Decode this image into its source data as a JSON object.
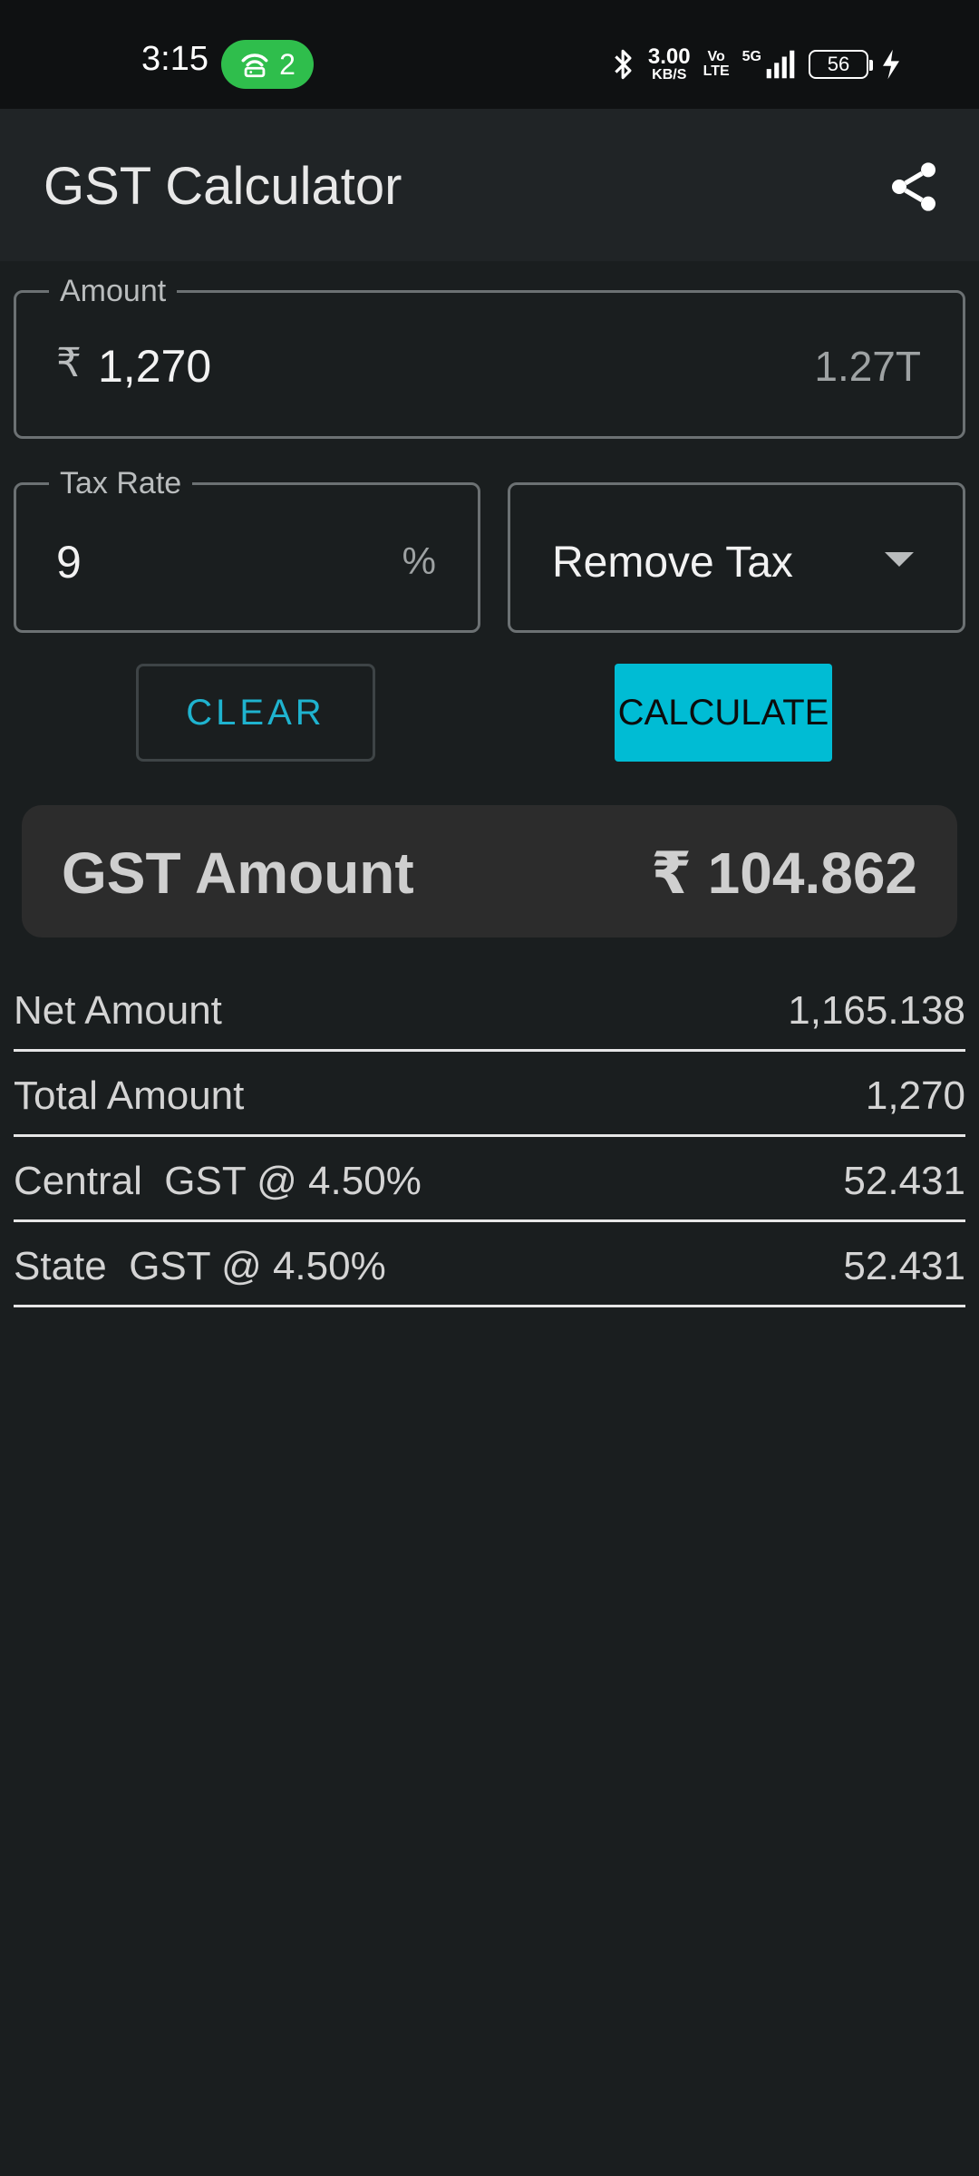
{
  "status_bar": {
    "time": "3:15",
    "hotspot_count": "2",
    "net_speed_value": "3.00",
    "net_speed_unit": "KB/S",
    "volte_top": "Vo",
    "volte_bottom": "LTE",
    "network_type": "5G",
    "battery_level": "56",
    "icons": [
      "hotspot-icon",
      "bluetooth-icon",
      "signal-icon",
      "battery-icon",
      "charging-icon"
    ]
  },
  "app_bar": {
    "title": "GST Calculator",
    "share_icon": "share-icon"
  },
  "amount_field": {
    "label": "Amount",
    "prefix": "₹",
    "value": "1,270",
    "suffix": "1.27T"
  },
  "tax_field": {
    "label": "Tax Rate",
    "value": "9",
    "suffix": "%"
  },
  "mode_select": {
    "selected": "Remove Tax"
  },
  "buttons": {
    "clear": "CLEAR",
    "calculate": "CALCULATE"
  },
  "gst_summary": {
    "label": "GST Amount",
    "value": "₹ 104.862"
  },
  "results": [
    {
      "label": "Net Amount",
      "value": "1,165.138"
    },
    {
      "label": "Total Amount",
      "value": "1,270"
    },
    {
      "label": "Central  GST @ 4.50%",
      "value": "52.431"
    },
    {
      "label": "State  GST @ 4.50%",
      "value": "52.431"
    }
  ],
  "colors": {
    "background": "#1a1e1f",
    "app_bar": "#202426",
    "accent": "#00bcd4",
    "card": "#2c2c2c",
    "hotspot": "#2fbe4c"
  }
}
